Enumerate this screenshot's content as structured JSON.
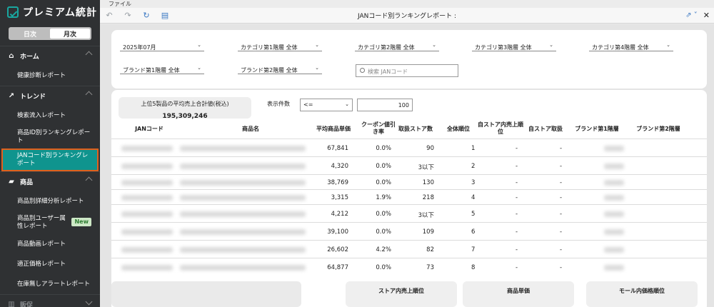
{
  "app": {
    "title": "プレミアム統計"
  },
  "toggle": {
    "daily": "日次",
    "monthly": "月次"
  },
  "sidebar": {
    "home": "ホーム",
    "health_report": "健康診断レポート",
    "trend": "トレンド",
    "search_inflow": "検索流入レポート",
    "product_id_ranking": "商品ID別ランキングレポート",
    "jan_ranking": "JANコード別ランキングレポート",
    "products": "商品",
    "product_detail": "商品別詳細分析レポート",
    "product_user_attr": "商品別ユーザー属性レポート",
    "new_badge": "New",
    "product_video": "商品動画レポート",
    "fair_price": "適正価格レポート",
    "out_of_stock": "在庫無しアラートレポート",
    "sales_promo": "販促"
  },
  "menubar": {
    "file": "ファイル"
  },
  "toolbar": {
    "title": "JANコード別ランキングレポート :"
  },
  "filters": {
    "period": "2025年07月",
    "cat1": "カテゴリ第1階層 全体",
    "cat2": "カテゴリ第2階層 全体",
    "cat3": "カテゴリ第3階層 全体",
    "cat4": "カテゴリ第4階層 全体",
    "brand1": "ブランド第1階層 全体",
    "brand2": "ブランド第2階層 全体",
    "search_placeholder": "検索 JANコード"
  },
  "summary": {
    "label": "上位5製品の平均売上合計値(税込)",
    "value": "195,309,246"
  },
  "display": {
    "label": "表示件数",
    "operator": "<=",
    "count": "100"
  },
  "table": {
    "headers": {
      "jan": "JANコード",
      "name": "商品名",
      "avg_price": "平均商品単価",
      "coupon": "クーポン値引き率",
      "stores": "取扱ストア数",
      "overall_rank": "全体順位",
      "own_rank": "自ストア内売上順位",
      "own_handling": "自ストア取扱",
      "brand1": "ブランド第1階層",
      "brand2": "ブランド第2階層"
    },
    "rows": [
      {
        "avg_price": "67,841",
        "coupon": "0.0%",
        "stores": "90",
        "rank": "1",
        "own_rank": "-",
        "own_handling": "-"
      },
      {
        "avg_price": "4,320",
        "coupon": "0.0%",
        "stores": "3以下",
        "rank": "2",
        "own_rank": "-",
        "own_handling": "-"
      },
      {
        "avg_price": "38,769",
        "coupon": "0.0%",
        "stores": "130",
        "rank": "3",
        "own_rank": "-",
        "own_handling": "-"
      },
      {
        "avg_price": "3,315",
        "coupon": "1.9%",
        "stores": "218",
        "rank": "4",
        "own_rank": "-",
        "own_handling": "-"
      },
      {
        "avg_price": "4,212",
        "coupon": "0.0%",
        "stores": "3以下",
        "rank": "5",
        "own_rank": "-",
        "own_handling": "-"
      },
      {
        "avg_price": "39,100",
        "coupon": "0.0%",
        "stores": "109",
        "rank": "6",
        "own_rank": "-",
        "own_handling": "-"
      },
      {
        "avg_price": "26,602",
        "coupon": "4.2%",
        "stores": "82",
        "rank": "7",
        "own_rank": "-",
        "own_handling": "-"
      },
      {
        "avg_price": "64,877",
        "coupon": "0.0%",
        "stores": "73",
        "rank": "8",
        "own_rank": "-",
        "own_handling": "-"
      }
    ]
  },
  "footer_cards": {
    "store_rank": "ストア内売上順位",
    "unit_price": "商品単価",
    "mall_price_rank": "モール内価格順位"
  },
  "icons": [
    "undo-icon",
    "redo-icon",
    "refresh-icon",
    "document-icon",
    "share-icon",
    "close-icon",
    "home-icon",
    "trend-icon",
    "folder-icon",
    "chart-icon",
    "chevron-up-icon",
    "chevron-down-icon"
  ],
  "colors": {
    "sidebar_bg": "#2f3133",
    "active_item": "#0f948e",
    "active_outline": "#e0601c",
    "accent": "#19a7a0"
  }
}
